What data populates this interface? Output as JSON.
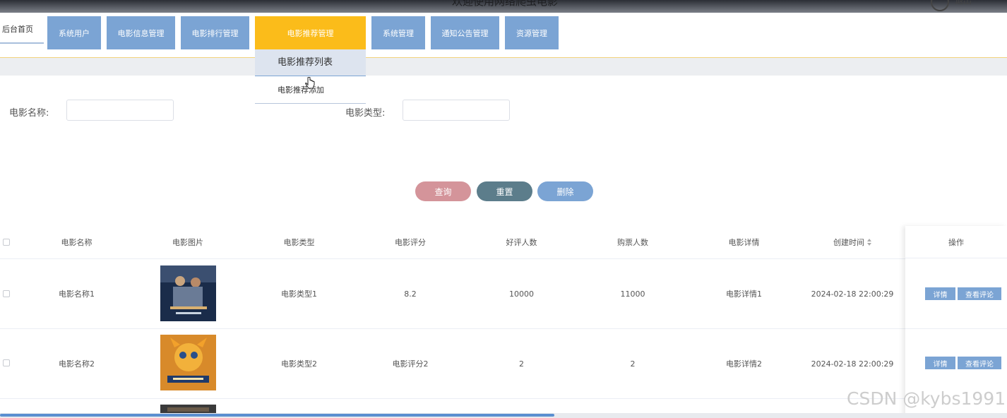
{
  "header": {
    "title": "欢迎使用网络爬虫电影",
    "user_label": "退出"
  },
  "nav": {
    "home": "后台首页",
    "items": [
      {
        "label": "系统用户"
      },
      {
        "label": "电影信息管理"
      },
      {
        "label": "电影排行管理"
      },
      {
        "label": "电影推荐管理"
      },
      {
        "label": "系统管理"
      },
      {
        "label": "通知公告管理"
      },
      {
        "label": "资源管理"
      }
    ],
    "active": "电影推荐管理",
    "active_color": "#fbbc1a",
    "item_color": "#7ba4d4"
  },
  "dropdown": {
    "items": [
      "电影推荐列表",
      "电影推荐添加"
    ]
  },
  "search": {
    "name_label": "电影名称:",
    "name_value": "",
    "type_label": "电影类型:",
    "type_value": ""
  },
  "buttons": {
    "query": "查询",
    "reset": "重置",
    "delete": "删除",
    "query_color": "#d4949a",
    "reset_color": "#5c7d8b",
    "delete_color": "#7ba4d4"
  },
  "table": {
    "columns": [
      "电影名称",
      "电影图片",
      "电影类型",
      "电影评分",
      "好评人数",
      "购票人数",
      "电影详情",
      "创建时间",
      "操作"
    ],
    "rows": [
      {
        "name": "电影名称1",
        "image": "poster-1",
        "type": "电影类型1",
        "score": "8.2",
        "good": "10000",
        "tickets": "11000",
        "detail": "电影详情1",
        "created": "2024-02-18 22:00:29"
      },
      {
        "name": "电影名称2",
        "image": "poster-2",
        "type": "电影类型2",
        "score": "电影评分2",
        "good": "2",
        "tickets": "2",
        "detail": "电影详情2",
        "created": "2024-02-18 22:00:29"
      }
    ],
    "row_actions": {
      "detail": "详情",
      "comments": "查看评论"
    }
  },
  "watermark": "CSDN @kybs1991"
}
